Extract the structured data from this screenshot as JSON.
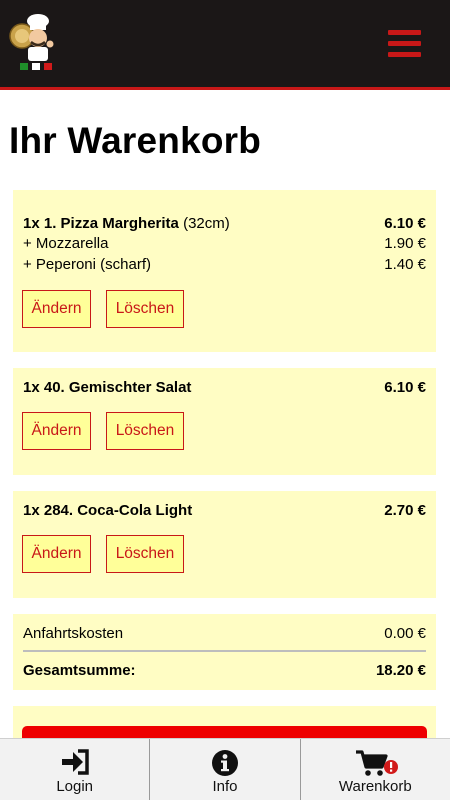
{
  "page_title": "Ihr Warenkorb",
  "items": [
    {
      "title_qty": "1x 1. Pizza Margherita",
      "title_extra": "(32cm)",
      "price": "6.10 €",
      "options": [
        {
          "label": "+ Mozzarella",
          "price": "1.90 €"
        },
        {
          "label": "+ Peperoni (scharf)",
          "price": "1.40 €"
        }
      ],
      "edit_label": "Ändern",
      "delete_label": "Löschen"
    },
    {
      "title_qty": "1x 40. Gemischter Salat",
      "price": "6.10 €",
      "edit_label": "Ändern",
      "delete_label": "Löschen"
    },
    {
      "title_qty": "1x 284. Coca-Cola Light",
      "price": "2.70 €",
      "edit_label": "Ändern",
      "delete_label": "Löschen"
    }
  ],
  "summary": {
    "delivery_label": "Anfahrtskosten",
    "delivery_value": "0.00 €",
    "total_label": "Gesamtsumme:",
    "total_value": "18.20 €"
  },
  "nav": [
    {
      "label": "Login",
      "icon": "login-icon"
    },
    {
      "label": "Info",
      "icon": "info-icon"
    },
    {
      "label": "Warenkorb",
      "icon": "cart-icon"
    }
  ],
  "colors": {
    "header_bg": "#1b1717",
    "accent_red": "#c81818",
    "card_bg": "#fffdc4",
    "button_bg": "#ffff99",
    "order_button": "#ee0000"
  }
}
